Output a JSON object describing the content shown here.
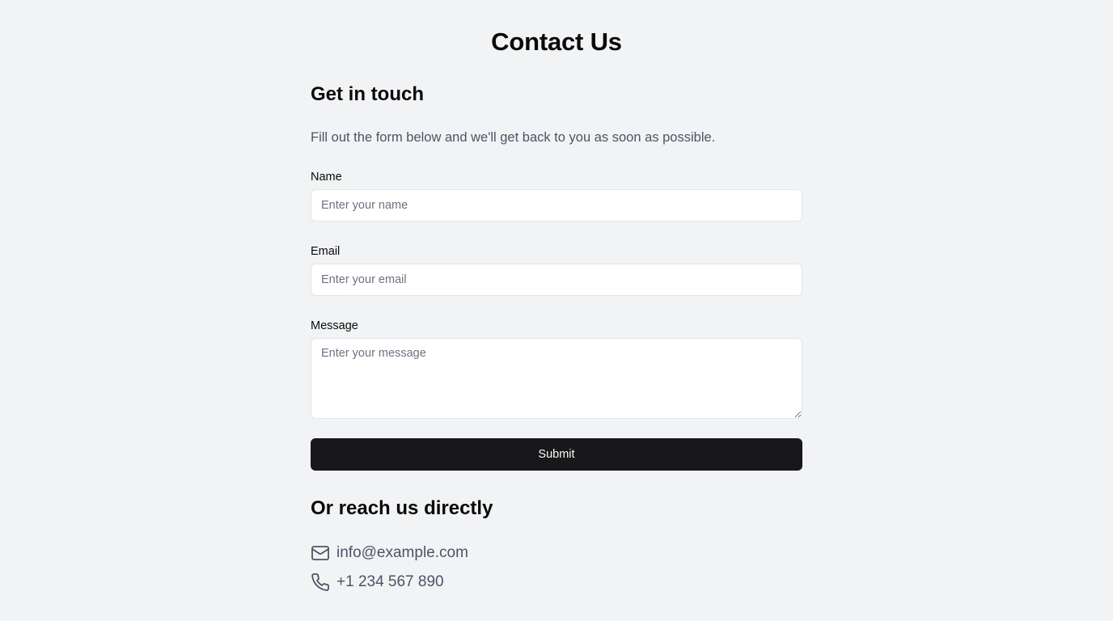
{
  "page": {
    "title": "Contact Us"
  },
  "form_section": {
    "heading": "Get in touch",
    "intro": "Fill out the form below and we'll get back to you as soon as possible.",
    "fields": {
      "name": {
        "label": "Name",
        "value": "",
        "placeholder": "Enter your name"
      },
      "email": {
        "label": "Email",
        "value": "",
        "placeholder": "Enter your email"
      },
      "message": {
        "label": "Message",
        "value": "",
        "placeholder": "Enter your message"
      }
    },
    "submit_label": "Submit"
  },
  "direct_section": {
    "heading": "Or reach us directly",
    "email": {
      "icon": "mail-icon",
      "text": "info@example.com"
    },
    "phone": {
      "icon": "phone-icon",
      "text": "+1 234 567 890"
    }
  },
  "colors": {
    "background": "#f2f3f5",
    "button": "#18181b",
    "muted_text": "#4b5563"
  }
}
